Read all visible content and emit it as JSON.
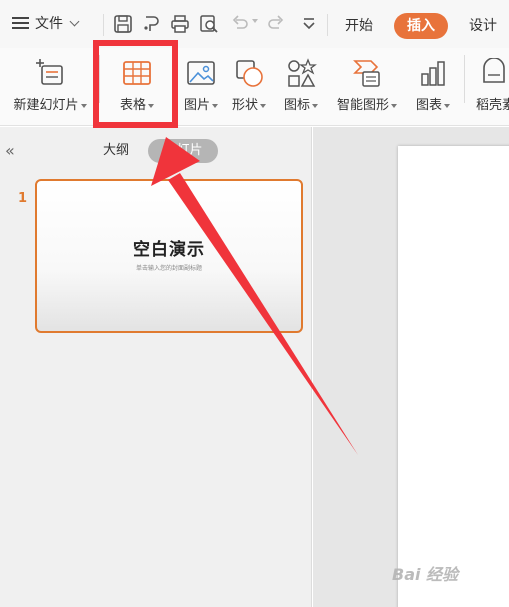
{
  "topbar": {
    "file_label": "文件",
    "tabs": [
      {
        "label": "开始",
        "active": false
      },
      {
        "label": "插入",
        "active": true
      },
      {
        "label": "设计",
        "active": false
      }
    ],
    "accent_color": "#e8733b"
  },
  "ribbon": {
    "new_slide": "新建幻灯片",
    "table": "表格",
    "picture": "图片",
    "shape": "形状",
    "icon": "图标",
    "smart_art": "智能图形",
    "chart": "图表",
    "docer": "稻壳素"
  },
  "left_panel": {
    "collapse_icon": "«",
    "tab_outline": "大纲",
    "tab_slides": "幻灯片",
    "slide_number": "1",
    "slide_title": "空白演示",
    "slide_subtitle": "单击输入您的封面副标题"
  },
  "annotation": {
    "highlight_color": "#f0343b",
    "arrow_color": "#f0343b"
  },
  "watermark": "Bai 经验"
}
